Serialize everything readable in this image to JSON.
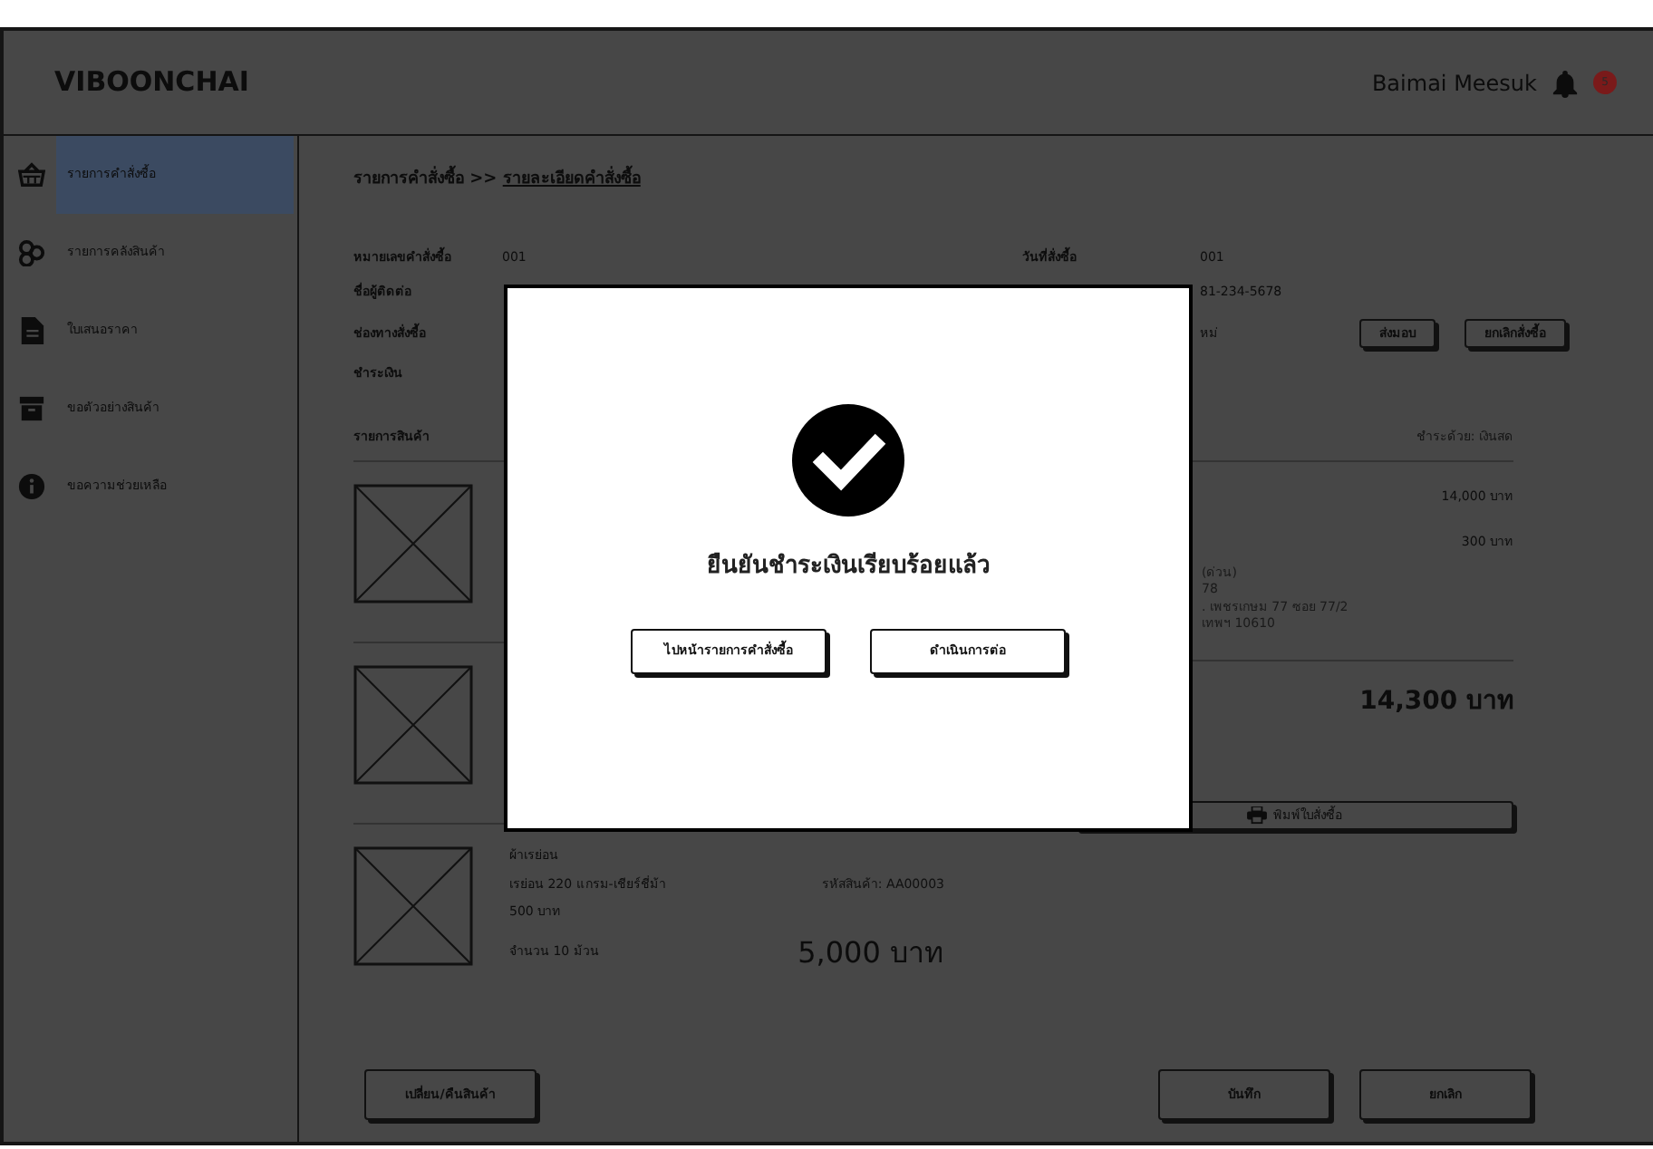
{
  "header": {
    "brand": "VIBOONCHAI",
    "user": "Baimai Meesuk",
    "notification_count": "5"
  },
  "sidebar": {
    "items": [
      {
        "label": "รายการคำสั่งซื้อ",
        "selected": true
      },
      {
        "label": "รายการคลังสินค้า",
        "selected": false
      },
      {
        "label": "ใบเสนอราคา",
        "selected": false
      },
      {
        "label": "ขอตัวอย่างสินค้า",
        "selected": false
      },
      {
        "label": "ขอความช่วยเหลือ",
        "selected": false
      }
    ]
  },
  "breadcrumb": {
    "parent": "รายการคำสั่งซื้อ >>",
    "current": "รายละเอียดคำสั่งซื้อ"
  },
  "order_info": {
    "left": [
      {
        "label": "หมายเลขคำสั่งซื้อ",
        "value": "001"
      },
      {
        "label": "ชื่อผู้ติดต่อ"
      },
      {
        "label": "ช่องทางสั่งซื้อ"
      },
      {
        "label": "ชำระเงิน"
      }
    ],
    "right": [
      {
        "label": "วันที่สั่งซื้อ",
        "value": "001"
      },
      {
        "value": "81-234-5678"
      },
      {
        "value": "หม่"
      }
    ],
    "actions": [
      "ส่งมอบ",
      "ยกเลิกสั่งซื้อ"
    ]
  },
  "items_header": {
    "title": "รายการสินค้า",
    "payment": "ชำระด้วย: เงินสด"
  },
  "products": [
    {
      "kind": "image-only"
    },
    {
      "kind": "image-only"
    },
    {
      "kind": "full",
      "name": "ผ้าเรย่อน",
      "spec": "เรย่อน 220 แกรม-เชียร์ชี่ม้า",
      "code": "รหัสสินค้า: AA00003",
      "unit_price": "500 บาท",
      "quantity": "จำนวน 10 ม้วน",
      "total": "5,000 บาท"
    }
  ],
  "summary": {
    "amounts": [
      "14,000 บาท",
      "300 บาท"
    ],
    "address_lines": [
      "(ด่วน)",
      "78",
      ". เพชรเกษม 77 ซอย 77/2",
      "เทพฯ 10610"
    ],
    "grand_total": "14,300 บาท",
    "print_button": "พิมพ์ใบสั่งซื้อ"
  },
  "footer_buttons": {
    "left": [
      "เปลี่ยน/คืนสินค้า"
    ],
    "right": [
      "บันทึก",
      "ยกเลิก"
    ]
  },
  "dialog": {
    "message": "ยืนยันชำระเงินเรียบร้อยแล้ว",
    "buttons": [
      "ไปหน้ารายการคำสั่งซื้อ",
      "ดำเนินการต่อ"
    ]
  }
}
